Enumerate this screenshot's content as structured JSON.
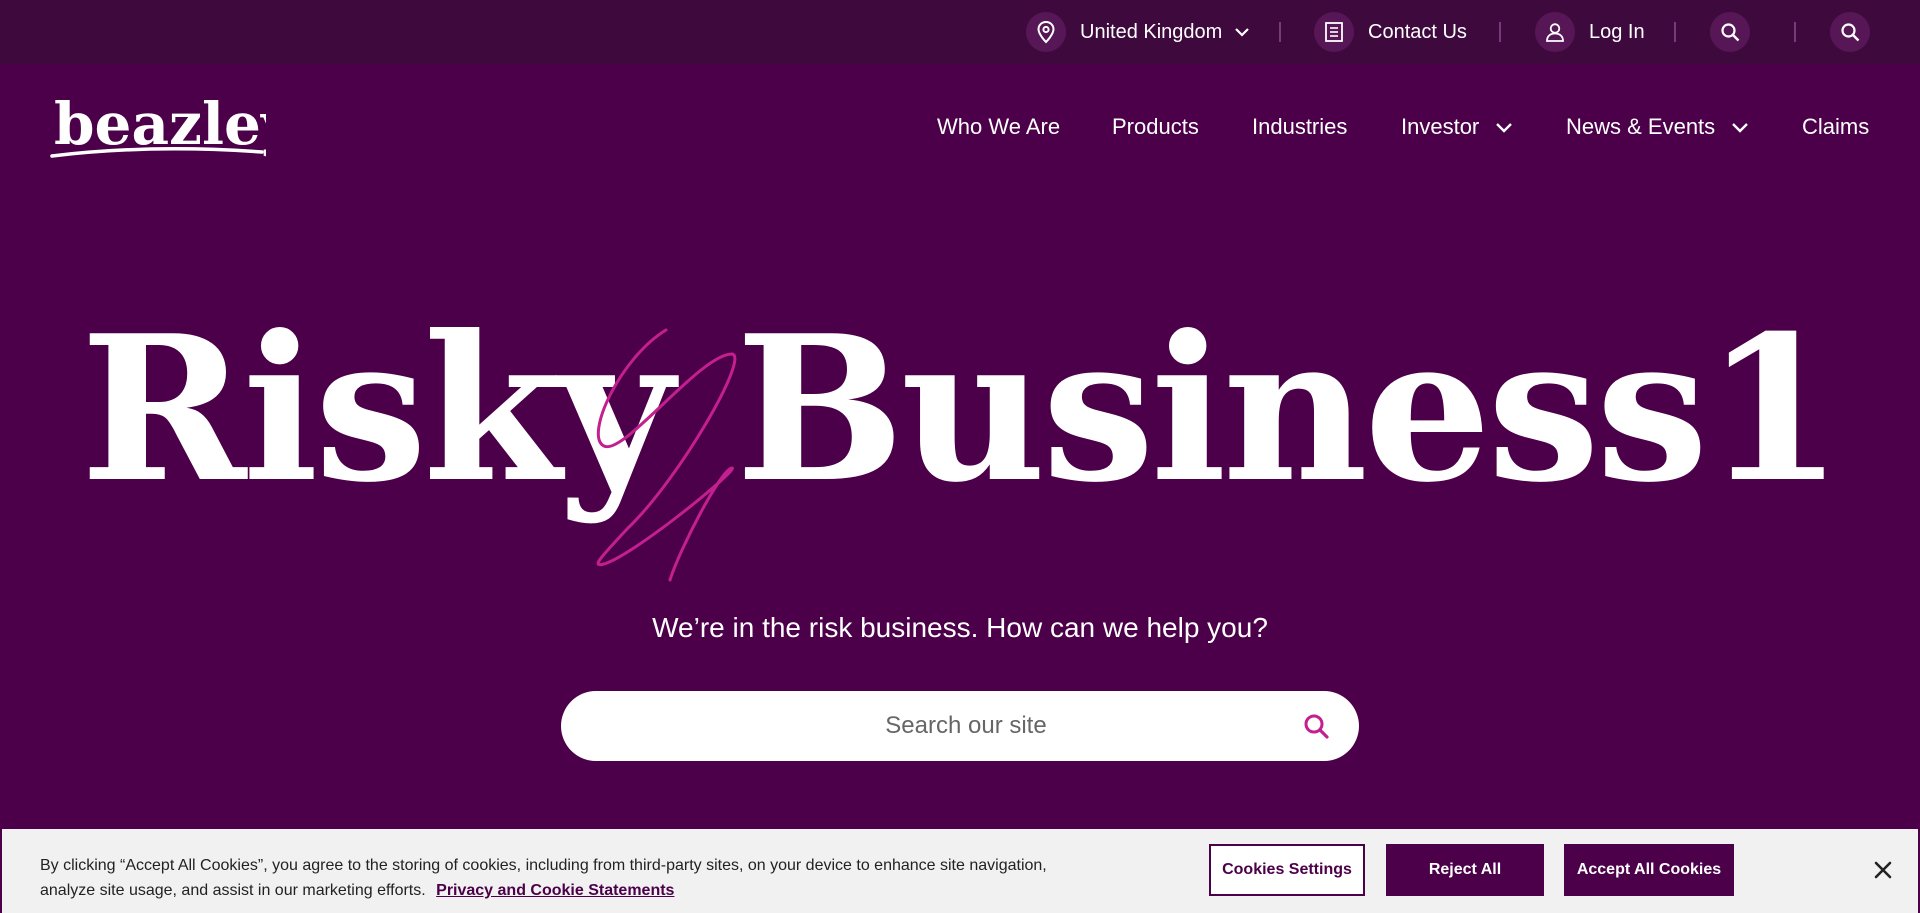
{
  "utility": {
    "region": "United Kingdom",
    "contact": "Contact Us",
    "login": "Log In"
  },
  "logo": {
    "text": "beazley"
  },
  "nav": {
    "items": [
      "Who We Are",
      "Products",
      "Industries",
      "Investor",
      "News & Events",
      "Claims"
    ]
  },
  "hero": {
    "title": "Risky Business1",
    "subtitle": "We’re in the risk business. How can we help you?",
    "search_placeholder": "Search our site"
  },
  "cookie": {
    "text": "By clicking “Accept All Cookies”, you agree to the storing of cookies, including from third-party sites, on your device to enhance site navigation, analyze site usage, and assist in our marketing efforts.",
    "link": "Privacy and Cookie Statements",
    "settings": "Cookies Settings",
    "reject": "Reject All",
    "accept": "Accept All Cookies"
  },
  "colors": {
    "brand_purple": "#4b0049",
    "utility_bar": "#3e0a3d",
    "accent_pink": "#c41f8e"
  },
  "icons": [
    "location-pin-icon",
    "chevron-down-icon",
    "contact-list-icon",
    "user-icon",
    "search-icon",
    "close-icon"
  ]
}
